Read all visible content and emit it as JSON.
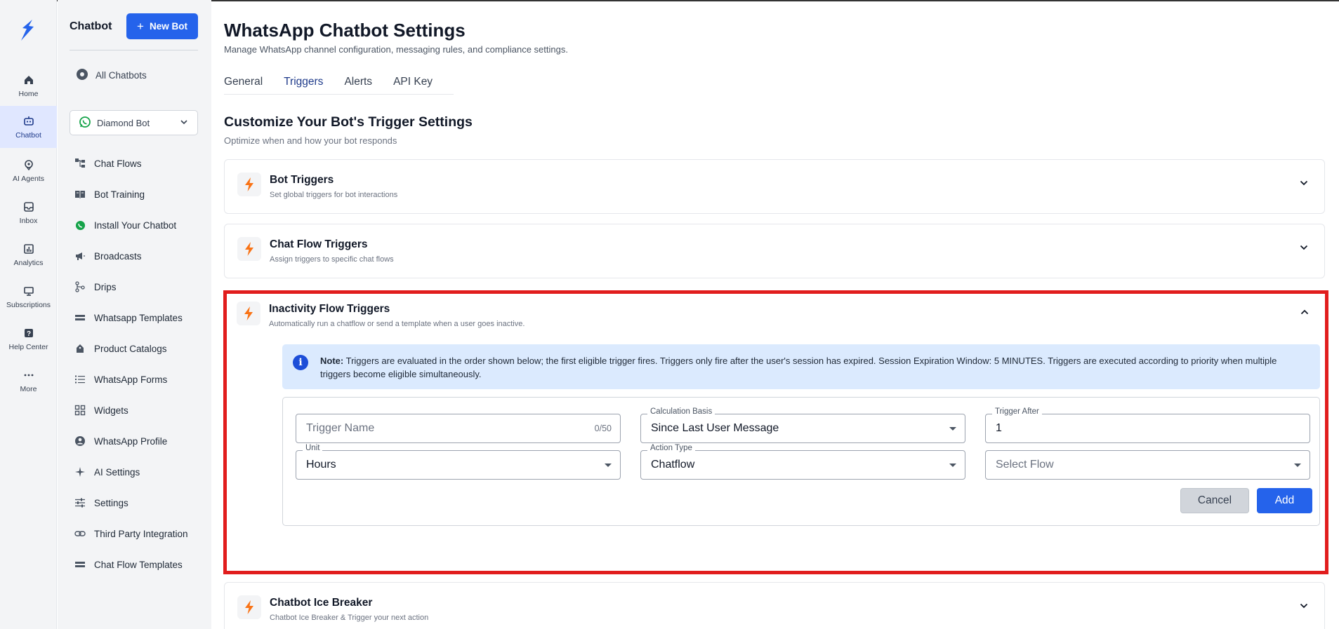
{
  "rail": {
    "items": [
      {
        "label": "Home",
        "icon": "home-icon"
      },
      {
        "label": "Chatbot",
        "icon": "robot-icon",
        "active": true
      },
      {
        "label": "AI Agents",
        "icon": "location-pin-icon"
      },
      {
        "label": "Inbox",
        "icon": "inbox-icon"
      },
      {
        "label": "Analytics",
        "icon": "analytics-icon"
      },
      {
        "label": "Subscriptions",
        "icon": "subscriptions-icon"
      },
      {
        "label": "Help Center",
        "icon": "help-icon"
      },
      {
        "label": "More",
        "icon": "more-dots-icon"
      }
    ]
  },
  "sidebar": {
    "title": "Chatbot",
    "new_bot": "New Bot",
    "all_chatbots": "All Chatbots",
    "selected_bot": "Diamond Bot",
    "items": [
      {
        "label": "Chat Flows",
        "icon": "flow-icon"
      },
      {
        "label": "Bot Training",
        "icon": "book-icon"
      },
      {
        "label": "Install Your Chatbot",
        "icon": "whatsapp-icon"
      },
      {
        "label": "Broadcasts",
        "icon": "megaphone-icon"
      },
      {
        "label": "Drips",
        "icon": "drips-icon"
      },
      {
        "label": "Whatsapp Templates",
        "icon": "template-icon"
      },
      {
        "label": "Product Catalogs",
        "icon": "catalog-icon"
      },
      {
        "label": "WhatsApp Forms",
        "icon": "list-icon"
      },
      {
        "label": "Widgets",
        "icon": "widgets-icon"
      },
      {
        "label": "WhatsApp Profile",
        "icon": "profile-icon"
      },
      {
        "label": "AI Settings",
        "icon": "sparkle-icon"
      },
      {
        "label": "Settings",
        "icon": "sliders-icon"
      },
      {
        "label": "Third Party Integration",
        "icon": "link-icon"
      },
      {
        "label": "Chat Flow Templates",
        "icon": "template-icon"
      }
    ]
  },
  "header": {
    "title": "WhatsApp Chatbot Settings",
    "subtitle": "Manage WhatsApp channel configuration, messaging rules, and compliance settings."
  },
  "tabs": [
    {
      "label": "General"
    },
    {
      "label": "Triggers",
      "active": true
    },
    {
      "label": "Alerts"
    },
    {
      "label": "API Key"
    }
  ],
  "section": {
    "title": "Customize Your Bot's Trigger Settings",
    "subtitle": "Optimize when and how your bot responds"
  },
  "cards": [
    {
      "title": "Bot Triggers",
      "subtitle": "Set global triggers for bot interactions",
      "expanded": false
    },
    {
      "title": "Chat Flow Triggers",
      "subtitle": "Assign triggers to specific chat flows",
      "expanded": false
    },
    {
      "title": "Inactivity Flow Triggers",
      "subtitle": "Automatically run a chatflow or send a template when a user goes inactive.",
      "expanded": true
    },
    {
      "title": "Chatbot Ice Breaker",
      "subtitle": "Chatbot Ice Breaker & Trigger your next action",
      "expanded": false
    }
  ],
  "note": {
    "label": "Note:",
    "text": "Triggers are evaluated in the order shown below; the first eligible trigger fires. Triggers only fire after the user's session has expired. Session Expiration Window: 5 MINUTES. Triggers are executed according to priority when multiple triggers become eligible simultaneously."
  },
  "form": {
    "trigger_name": {
      "placeholder": "Trigger Name",
      "counter": "0/50"
    },
    "calculation_basis": {
      "label": "Calculation Basis",
      "value": "Since Last User Message"
    },
    "trigger_after": {
      "label": "Trigger After",
      "value": "1"
    },
    "unit": {
      "label": "Unit",
      "value": "Hours"
    },
    "action_type": {
      "label": "Action Type",
      "value": "Chatflow"
    },
    "select_flow": {
      "placeholder": "Select Flow"
    },
    "cancel": "Cancel",
    "add": "Add"
  },
  "colors": {
    "accent": "#2563eb",
    "bolt": "#f97316",
    "highlight": "#e11d1d",
    "note_bg": "#dbeafe"
  }
}
